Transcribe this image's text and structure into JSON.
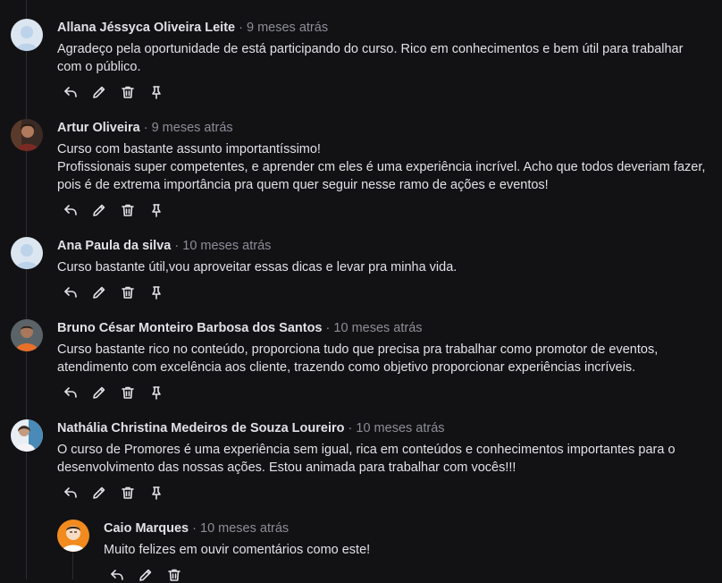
{
  "comments": [
    {
      "author": "Allana Jéssyca Oliveira Leite",
      "time": "9 meses atrás",
      "lines": [
        "Agradeço pela oportunidade de está participando do curso. Rico em conhecimentos e bem útil para trabalhar com o público."
      ]
    },
    {
      "author": "Artur Oliveira",
      "time": "9 meses atrás",
      "lines": [
        "Curso com bastante assunto importantíssimo!",
        "Profissionais super competentes, e aprender cm eles é uma experiência incrível. Acho que todos deveriam fazer, pois é de extrema importância pra quem quer seguir nesse ramo de ações e eventos!"
      ]
    },
    {
      "author": "Ana Paula da silva",
      "time": "10 meses atrás",
      "lines": [
        "Curso bastante útil,vou aproveitar essas dicas e levar pra minha vida."
      ]
    },
    {
      "author": "Bruno César Monteiro Barbosa dos Santos",
      "time": "10 meses atrás",
      "lines": [
        "Curso bastante rico no conteúdo, proporciona tudo que precisa pra trabalhar como promotor de eventos, atendimento com excelência aos cliente, trazendo como objetivo proporcionar experiências incríveis."
      ]
    },
    {
      "author": "Nathália Christina Medeiros de Souza Loureiro",
      "time": "10 meses atrás",
      "lines": [
        "O curso de Promores é uma experiência sem igual, rica em conteúdos e conhecimentos importantes para o desenvolvimento das nossas ações. Estou animada para trabalhar com vocês!!!"
      ]
    },
    {
      "author": "Caio Marques",
      "time": "10 meses atrás",
      "lines": [
        "Muito felizes em ouvir comentários como este!"
      ]
    }
  ],
  "separator": "·",
  "icons": {
    "reply": "reply-icon",
    "edit": "pencil-icon",
    "delete": "trash-icon",
    "pin": "pin-icon"
  },
  "colors": {
    "background": "#121214",
    "text": "#e1e1e6",
    "muted": "#8d8d99",
    "thread_line": "#2c2c31"
  }
}
